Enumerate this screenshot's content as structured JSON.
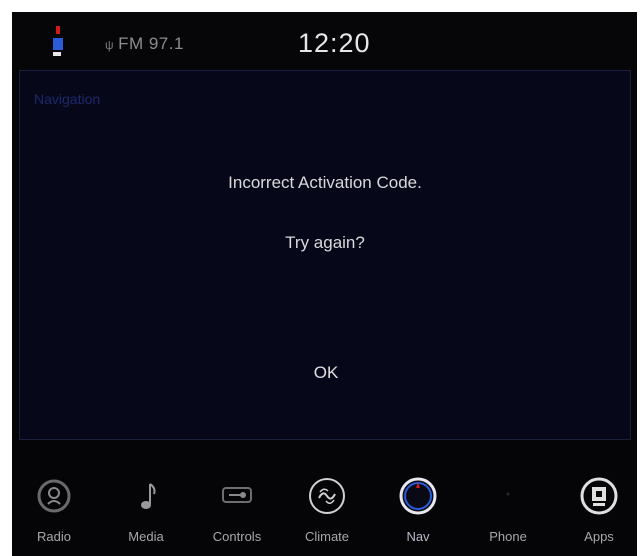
{
  "status": {
    "radio": "FM 97.1",
    "time": "12:20"
  },
  "panel": {
    "title": "Navigation",
    "message_line1": "Incorrect Activation Code.",
    "message_line2": "Try again?",
    "ok_label": "OK"
  },
  "nav": {
    "items": [
      {
        "label": "Radio",
        "icon": "radio-icon"
      },
      {
        "label": "Media",
        "icon": "music-note-icon"
      },
      {
        "label": "Controls",
        "icon": "controls-icon"
      },
      {
        "label": "Climate",
        "icon": "climate-fan-icon"
      },
      {
        "label": "Nav",
        "icon": "compass-icon"
      },
      {
        "label": "Phone",
        "icon": "phone-icon"
      },
      {
        "label": "Apps",
        "icon": "apps-icon"
      }
    ],
    "active": "Nav"
  },
  "colors": {
    "background": "#050508",
    "panel": "#07071a",
    "text": "#d9d9d9",
    "accent_red": "#d21a1a",
    "accent_blue": "#2b5bd8"
  }
}
